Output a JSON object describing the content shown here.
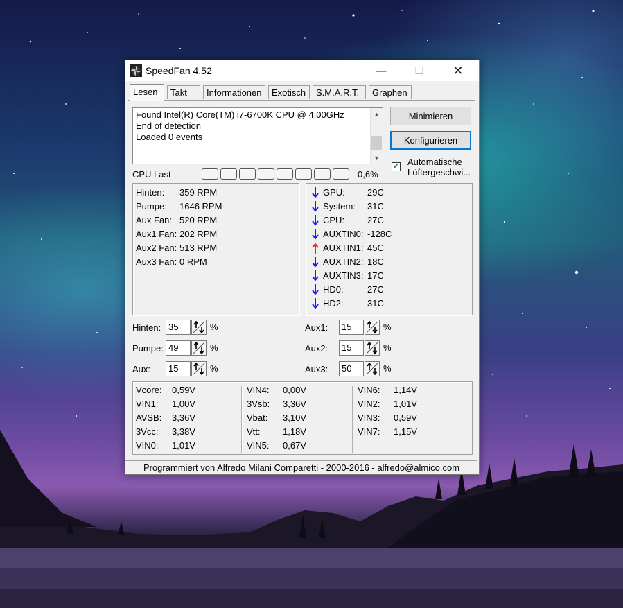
{
  "window": {
    "title": "SpeedFan 4.52",
    "minimize_glyph": "—",
    "maximize_glyph": "☐",
    "close_glyph": "✕"
  },
  "tabs": [
    {
      "label": "Lesen",
      "active": true
    },
    {
      "label": "Takt",
      "active": false
    },
    {
      "label": "Informationen",
      "active": false
    },
    {
      "label": "Exotisch",
      "active": false
    },
    {
      "label": "S.M.A.R.T.",
      "active": false
    },
    {
      "label": "Graphen",
      "active": false
    }
  ],
  "log": {
    "lines": [
      "Found Intel(R) Core(TM) i7-6700K CPU @ 4.00GHz",
      "End of detection",
      "Loaded 0 events"
    ]
  },
  "buttons": {
    "minimize": "Minimieren",
    "configure": "Konfigurieren"
  },
  "auto_fan": {
    "label_line1": "Automatische",
    "label_line2": "Lüftergeschwi...",
    "checked": true
  },
  "cpu_load": {
    "label": "CPU Last",
    "value": "0,6%",
    "segments": 8
  },
  "fans": [
    {
      "label": "Hinten:",
      "value": "359 RPM"
    },
    {
      "label": "Pumpe:",
      "value": "1646 RPM"
    },
    {
      "label": "Aux Fan:",
      "value": "520 RPM"
    },
    {
      "label": "Aux1 Fan:",
      "value": "202 RPM"
    },
    {
      "label": "Aux2 Fan:",
      "value": "513 RPM"
    },
    {
      "label": "Aux3 Fan:",
      "value": "0 RPM"
    }
  ],
  "temps": [
    {
      "label": "GPU:",
      "value": "29C",
      "trend": "down",
      "color": "#1a1aff"
    },
    {
      "label": "System:",
      "value": "31C",
      "trend": "down",
      "color": "#1a1aff"
    },
    {
      "label": "CPU:",
      "value": "27C",
      "trend": "down",
      "color": "#1a1aff"
    },
    {
      "label": "AUXTIN0:",
      "value": "-128C",
      "trend": "down",
      "color": "#1a1aff"
    },
    {
      "label": "AUXTIN1:",
      "value": "45C",
      "trend": "up",
      "color": "#ff1a1a"
    },
    {
      "label": "AUXTIN2:",
      "value": "18C",
      "trend": "down",
      "color": "#1a1aff"
    },
    {
      "label": "AUXTIN3:",
      "value": "17C",
      "trend": "down",
      "color": "#1a1aff"
    },
    {
      "label": "HD0:",
      "value": "27C",
      "trend": "down",
      "color": "#1a1aff"
    },
    {
      "label": "HD2:",
      "value": "31C",
      "trend": "down",
      "color": "#1a1aff"
    }
  ],
  "speeds_left": [
    {
      "label": "Hinten:",
      "value": "35",
      "unit": "%"
    },
    {
      "label": "Pumpe:",
      "value": "49",
      "unit": "%"
    },
    {
      "label": "Aux:",
      "value": "15",
      "unit": "%"
    }
  ],
  "speeds_right": [
    {
      "label": "Aux1:",
      "value": "15",
      "unit": "%"
    },
    {
      "label": "Aux2:",
      "value": "15",
      "unit": "%"
    },
    {
      "label": "Aux3:",
      "value": "50",
      "unit": "%"
    }
  ],
  "voltages": [
    [
      {
        "label": "Vcore:",
        "value": "0,59V"
      },
      {
        "label": "VIN1:",
        "value": "1,00V"
      },
      {
        "label": "AVSB:",
        "value": "3,36V"
      },
      {
        "label": "3Vcc:",
        "value": "3,38V"
      },
      {
        "label": "VIN0:",
        "value": "1,01V"
      }
    ],
    [
      {
        "label": "VIN4:",
        "value": "0,00V"
      },
      {
        "label": "3Vsb:",
        "value": "3,36V"
      },
      {
        "label": "Vbat:",
        "value": "3,10V"
      },
      {
        "label": "Vtt:",
        "value": "1,18V"
      },
      {
        "label": "VIN5:",
        "value": "0,67V"
      }
    ],
    [
      {
        "label": "VIN6:",
        "value": "1,14V"
      },
      {
        "label": "VIN2:",
        "value": "1,01V"
      },
      {
        "label": "VIN3:",
        "value": "0,59V"
      },
      {
        "label": "VIN7:",
        "value": "1,15V"
      }
    ]
  ],
  "status": "Programmiert von Alfredo Milani Comparetti - 2000-2016 - alfredo@almico.com"
}
